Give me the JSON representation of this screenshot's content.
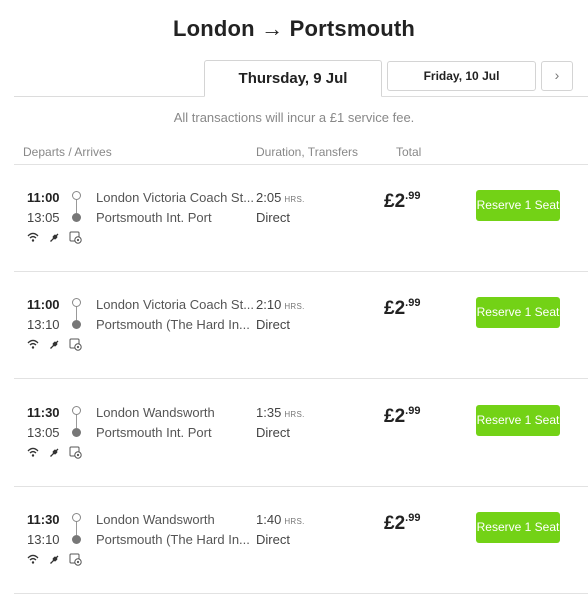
{
  "header": {
    "title": "London → Portsmouth"
  },
  "date_tabs": {
    "active": "Thursday, 9 Jul",
    "next": "Friday, 10 Jul",
    "arrow": "›"
  },
  "notice": "All transactions will incur a £1 service fee.",
  "columns": {
    "departs_arrives": "Departs / Arrives",
    "duration": "Duration, Transfers",
    "total": "Total"
  },
  "colors": {
    "reserve_button": "#73d216"
  },
  "amenity_icons": [
    "wifi-icon",
    "power-plug-icon",
    "settings-icon"
  ],
  "results": [
    {
      "depart": "11:00",
      "arrive": "13:05",
      "from": "London Victoria Coach St...",
      "to": "Portsmouth Int. Port",
      "duration": "2:05",
      "duration_unit": "HRS.",
      "transfers": "Direct",
      "price_main": "£2",
      "price_cents": ".99",
      "button": "Reserve 1 Seat"
    },
    {
      "depart": "11:00",
      "arrive": "13:10",
      "from": "London Victoria Coach St...",
      "to": "Portsmouth (The Hard In...",
      "duration": "2:10",
      "duration_unit": "HRS.",
      "transfers": "Direct",
      "price_main": "£2",
      "price_cents": ".99",
      "button": "Reserve 1 Seat"
    },
    {
      "depart": "11:30",
      "arrive": "13:05",
      "from": "London Wandsworth",
      "to": "Portsmouth Int. Port",
      "duration": "1:35",
      "duration_unit": "HRS.",
      "transfers": "Direct",
      "price_main": "£2",
      "price_cents": ".99",
      "button": "Reserve 1 Seat"
    },
    {
      "depart": "11:30",
      "arrive": "13:10",
      "from": "London Wandsworth",
      "to": "Portsmouth (The Hard In...",
      "duration": "1:40",
      "duration_unit": "HRS.",
      "transfers": "Direct",
      "price_main": "£2",
      "price_cents": ".99",
      "button": "Reserve 1 Seat"
    }
  ]
}
